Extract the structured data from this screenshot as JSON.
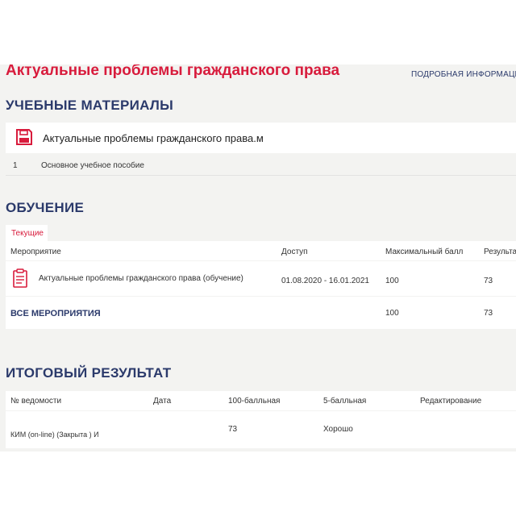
{
  "page": {
    "course_title": "Актуальные проблемы гражданского права",
    "more_info_link": "ПОДРОБНАЯ ИНФОРМАЦИЯ"
  },
  "materials": {
    "heading": "УЧЕБНЫЕ МАТЕРИАЛЫ",
    "file_icon": "floppy-disk-icon",
    "file_title": "Актуальные проблемы гражданского права.м",
    "items": [
      {
        "num": "1",
        "label": "Основное учебное пособие"
      }
    ]
  },
  "learning": {
    "heading": "ОБУЧЕНИЕ",
    "tab_current": "Текущие",
    "columns": [
      "Мероприятие",
      "Доступ",
      "Максимальный балл",
      "Результат"
    ],
    "activity_icon": "clipboard-icon",
    "rows": [
      {
        "name": "Актуальные проблемы гражданского права (обучение)",
        "access": "01.08.2020 - 16.01.2021",
        "max": "100",
        "result": "73"
      }
    ],
    "total": {
      "label": "ВСЕ МЕРОПРИЯТИЯ",
      "max": "100",
      "result": "73"
    }
  },
  "final": {
    "heading": "ИТОГОВЫЙ РЕЗУЛЬТАТ",
    "columns": [
      "№ ведомости",
      "Дата",
      "100-балльная",
      "5-балльная",
      "Редактирование"
    ],
    "rows": [
      {
        "statement": "КИМ (on-line) (Закрыта ) И",
        "date": "",
        "score100": "73",
        "score5": "Хорошо",
        "edit": ""
      }
    ]
  },
  "colors": {
    "accent_red": "#d81b3c",
    "navy": "#2b3a6b",
    "background": "#f3f3f1"
  }
}
